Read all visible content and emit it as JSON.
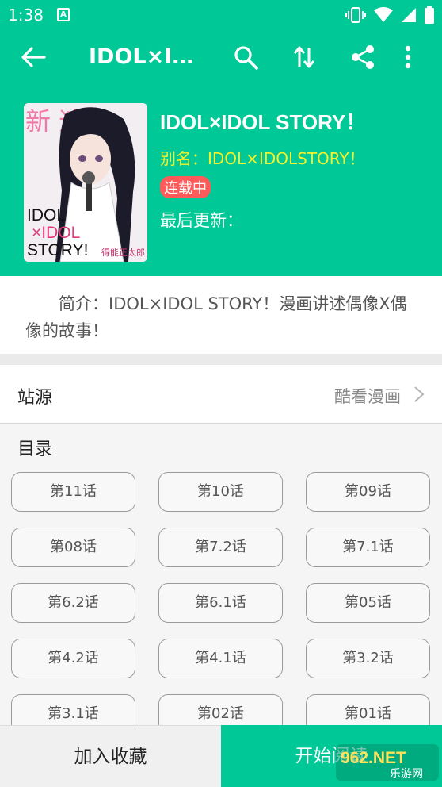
{
  "status_bar": {
    "time": "1:38",
    "notif_letter": "A"
  },
  "app_bar": {
    "title": "IDOL×ID…"
  },
  "comic": {
    "title": "IDOL×IDOL STORY！",
    "alias": "别名：IDOL×IDOLSTORY！",
    "status_badge": "连载中",
    "last_update": "最后更新：",
    "intro": "简介：IDOL×IDOL STORY！漫画讲述偶像X偶像的故事！"
  },
  "cover_art": {
    "top_text": "新 速",
    "title_line1": "IDOL",
    "title_line2": "×IDOL",
    "title_line3": "STORY!",
    "author": "得能正太郎"
  },
  "source": {
    "label": "站源",
    "value": "酷看漫画"
  },
  "toc": {
    "title": "目录",
    "chapters": [
      "第11话",
      "第10话",
      "第09话",
      "第08话",
      "第7.2话",
      "第7.1话",
      "第6.2话",
      "第6.1话",
      "第05话",
      "第4.2话",
      "第4.1话",
      "第3.2话",
      "第3.1话",
      "第02话",
      "第01话"
    ]
  },
  "bottom_bar": {
    "favorite": "加入收藏",
    "start_reading": "开始阅读"
  },
  "watermark": {
    "brand": "962.NET",
    "sub": "乐游网"
  },
  "colors": {
    "primary": "#00c896",
    "alias": "#f6f22a",
    "badge": "#ff5a5a"
  }
}
